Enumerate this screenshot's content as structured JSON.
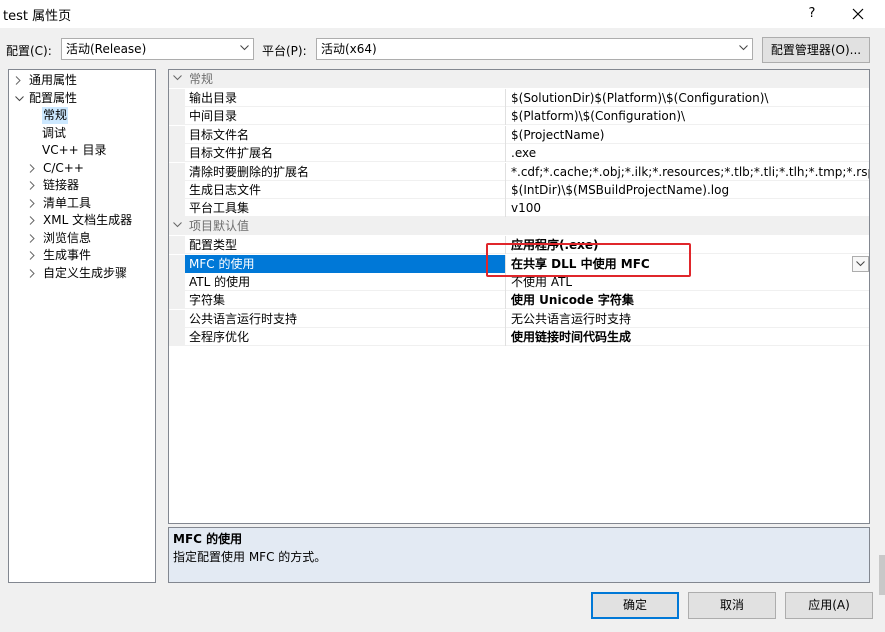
{
  "window": {
    "title": "test 属性页",
    "help": "?",
    "close_icon": "close-icon"
  },
  "config": {
    "label": "配置(C):",
    "value": "活动(Release)"
  },
  "platform": {
    "label": "平台(P):",
    "value": "活动(x64)"
  },
  "config_manager": "配置管理器(O)...",
  "tree": [
    {
      "label": "通用属性",
      "state": "collapsed"
    },
    {
      "label": "配置属性",
      "state": "expanded"
    },
    {
      "label": "常规",
      "state": "leaf"
    },
    {
      "label": "调试",
      "state": "leaf"
    },
    {
      "label": "VC++ 目录",
      "state": "leaf"
    },
    {
      "label": "C/C++",
      "state": "collapsed"
    },
    {
      "label": "链接器",
      "state": "collapsed"
    },
    {
      "label": "清单工具",
      "state": "collapsed"
    },
    {
      "label": "XML 文档生成器",
      "state": "collapsed"
    },
    {
      "label": "浏览信息",
      "state": "collapsed"
    },
    {
      "label": "生成事件",
      "state": "collapsed"
    },
    {
      "label": "自定义生成步骤",
      "state": "collapsed"
    }
  ],
  "grid": {
    "categories": [
      {
        "name": "常规",
        "rows": [
          {
            "name": "输出目录",
            "value": "$(SolutionDir)$(Platform)\\$(Configuration)\\"
          },
          {
            "name": "中间目录",
            "value": "$(Platform)\\$(Configuration)\\"
          },
          {
            "name": "目标文件名",
            "value": "$(ProjectName)"
          },
          {
            "name": "目标文件扩展名",
            "value": ".exe"
          },
          {
            "name": "清除时要删除的扩展名",
            "value": "*.cdf;*.cache;*.obj;*.ilk;*.resources;*.tlb;*.tli;*.tlh;*.tmp;*.rsp;*.p"
          },
          {
            "name": "生成日志文件",
            "value": "$(IntDir)\\$(MSBuildProjectName).log"
          },
          {
            "name": "平台工具集",
            "value": "v100"
          }
        ]
      },
      {
        "name": "项目默认值",
        "rows": [
          {
            "name": "配置类型",
            "value": "应用程序(.exe)"
          },
          {
            "name": "MFC 的使用",
            "value": "在共享 DLL 中使用 MFC"
          },
          {
            "name": "ATL 的使用",
            "value": "不使用 ATL"
          },
          {
            "name": "字符集",
            "value": "使用 Unicode 字符集"
          },
          {
            "name": "公共语言运行时支持",
            "value": "无公共语言运行时支持"
          },
          {
            "name": "全程序优化",
            "value": "使用链接时间代码生成"
          }
        ]
      }
    ]
  },
  "description": {
    "title": "MFC 的使用",
    "text": "指定配置使用 MFC 的方式。"
  },
  "buttons": {
    "ok": "确定",
    "cancel": "取消",
    "apply": "应用(A)"
  },
  "colors": {
    "selection": "#0078d7",
    "annotation": "#e0262b"
  }
}
